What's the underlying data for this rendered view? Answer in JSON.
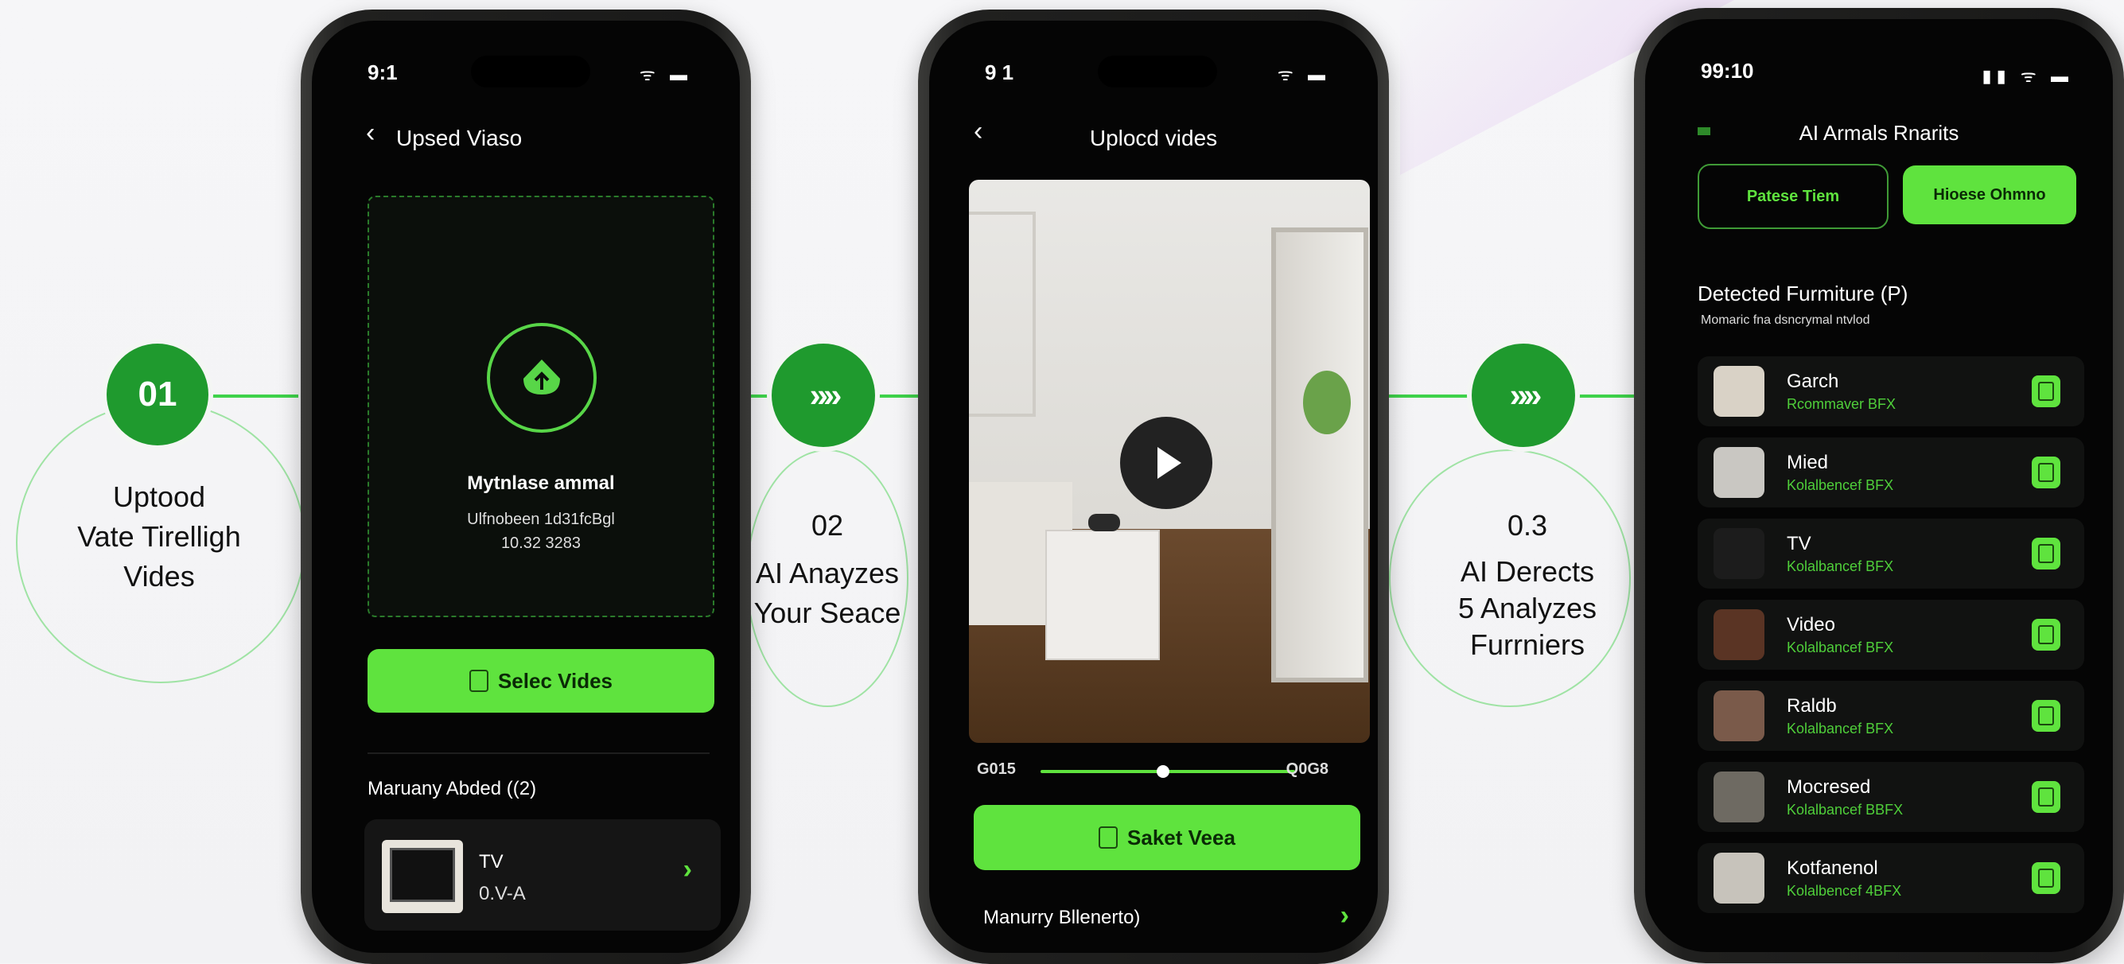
{
  "steps": [
    {
      "number": "01",
      "lines": [
        "Uptood",
        "Vate Tirelligh",
        "Vides"
      ]
    },
    {
      "number": "02",
      "lines": [
        "AI Anayzes",
        "Your Seace"
      ]
    },
    {
      "number": "0.3",
      "lines": [
        "AI Derects",
        "5 Analyzes",
        "Furrniers"
      ]
    }
  ],
  "connector_glyph": "»»",
  "phone1": {
    "time": "9:1",
    "status_icons": "ᯤ ▬",
    "title": "Upsed Viaso",
    "back_glyph": "‹",
    "drop_title": "Mytnlase ammal",
    "drop_line1": "Ulfnobeen 1d31fcBgl",
    "drop_line2": "10.32 3283",
    "select_button": "Selec Vides",
    "recent_heading": "Maruany Abded ((2)",
    "recent_item": {
      "name": "TV",
      "meta": "0.V-A",
      "chevron": "›"
    }
  },
  "phone2": {
    "time": "9 1",
    "status_icons": "ᯤ ▬",
    "title": "Uplocd vides",
    "back_glyph": "‹",
    "time_start": "G015",
    "time_end": "Q0G8",
    "progress": 0.48,
    "select_button": "Saket Veea",
    "bottom_row": "Manurry Bllenerto)",
    "bottom_chevron": "›"
  },
  "phone3": {
    "time": "99:10",
    "status_icons": "▮▮ ᯤ ▬",
    "title": "AI Armals Rnarits",
    "tab_left": "Patese Tiem",
    "tab_right": "Hioese Ohmno",
    "heading": "Detected Furmiture (P)",
    "subheading": "Momaric fna dsncrymal ntvlod",
    "items": [
      {
        "name": "Garch",
        "sub": "Rcommaver BFX",
        "thumb": "#d9d2c6"
      },
      {
        "name": "Mied",
        "sub": "Kolalbencef BFX",
        "thumb": "#c9c7c2"
      },
      {
        "name": "TV",
        "sub": "Kolalbancef BFX",
        "thumb": "#1c1c1c"
      },
      {
        "name": "Video",
        "sub": "Kolalbancef BFX",
        "thumb": "#5a3424"
      },
      {
        "name": "Raldb",
        "sub": "Kolalbancef BFX",
        "thumb": "#7a5a4a"
      },
      {
        "name": "Mocresed",
        "sub": "Kolalbancef BBFX",
        "thumb": "#6e6a62"
      },
      {
        "name": "Kotfanenol",
        "sub": "Kolalbencef 4BFX",
        "thumb": "#c7c3bb"
      }
    ]
  }
}
